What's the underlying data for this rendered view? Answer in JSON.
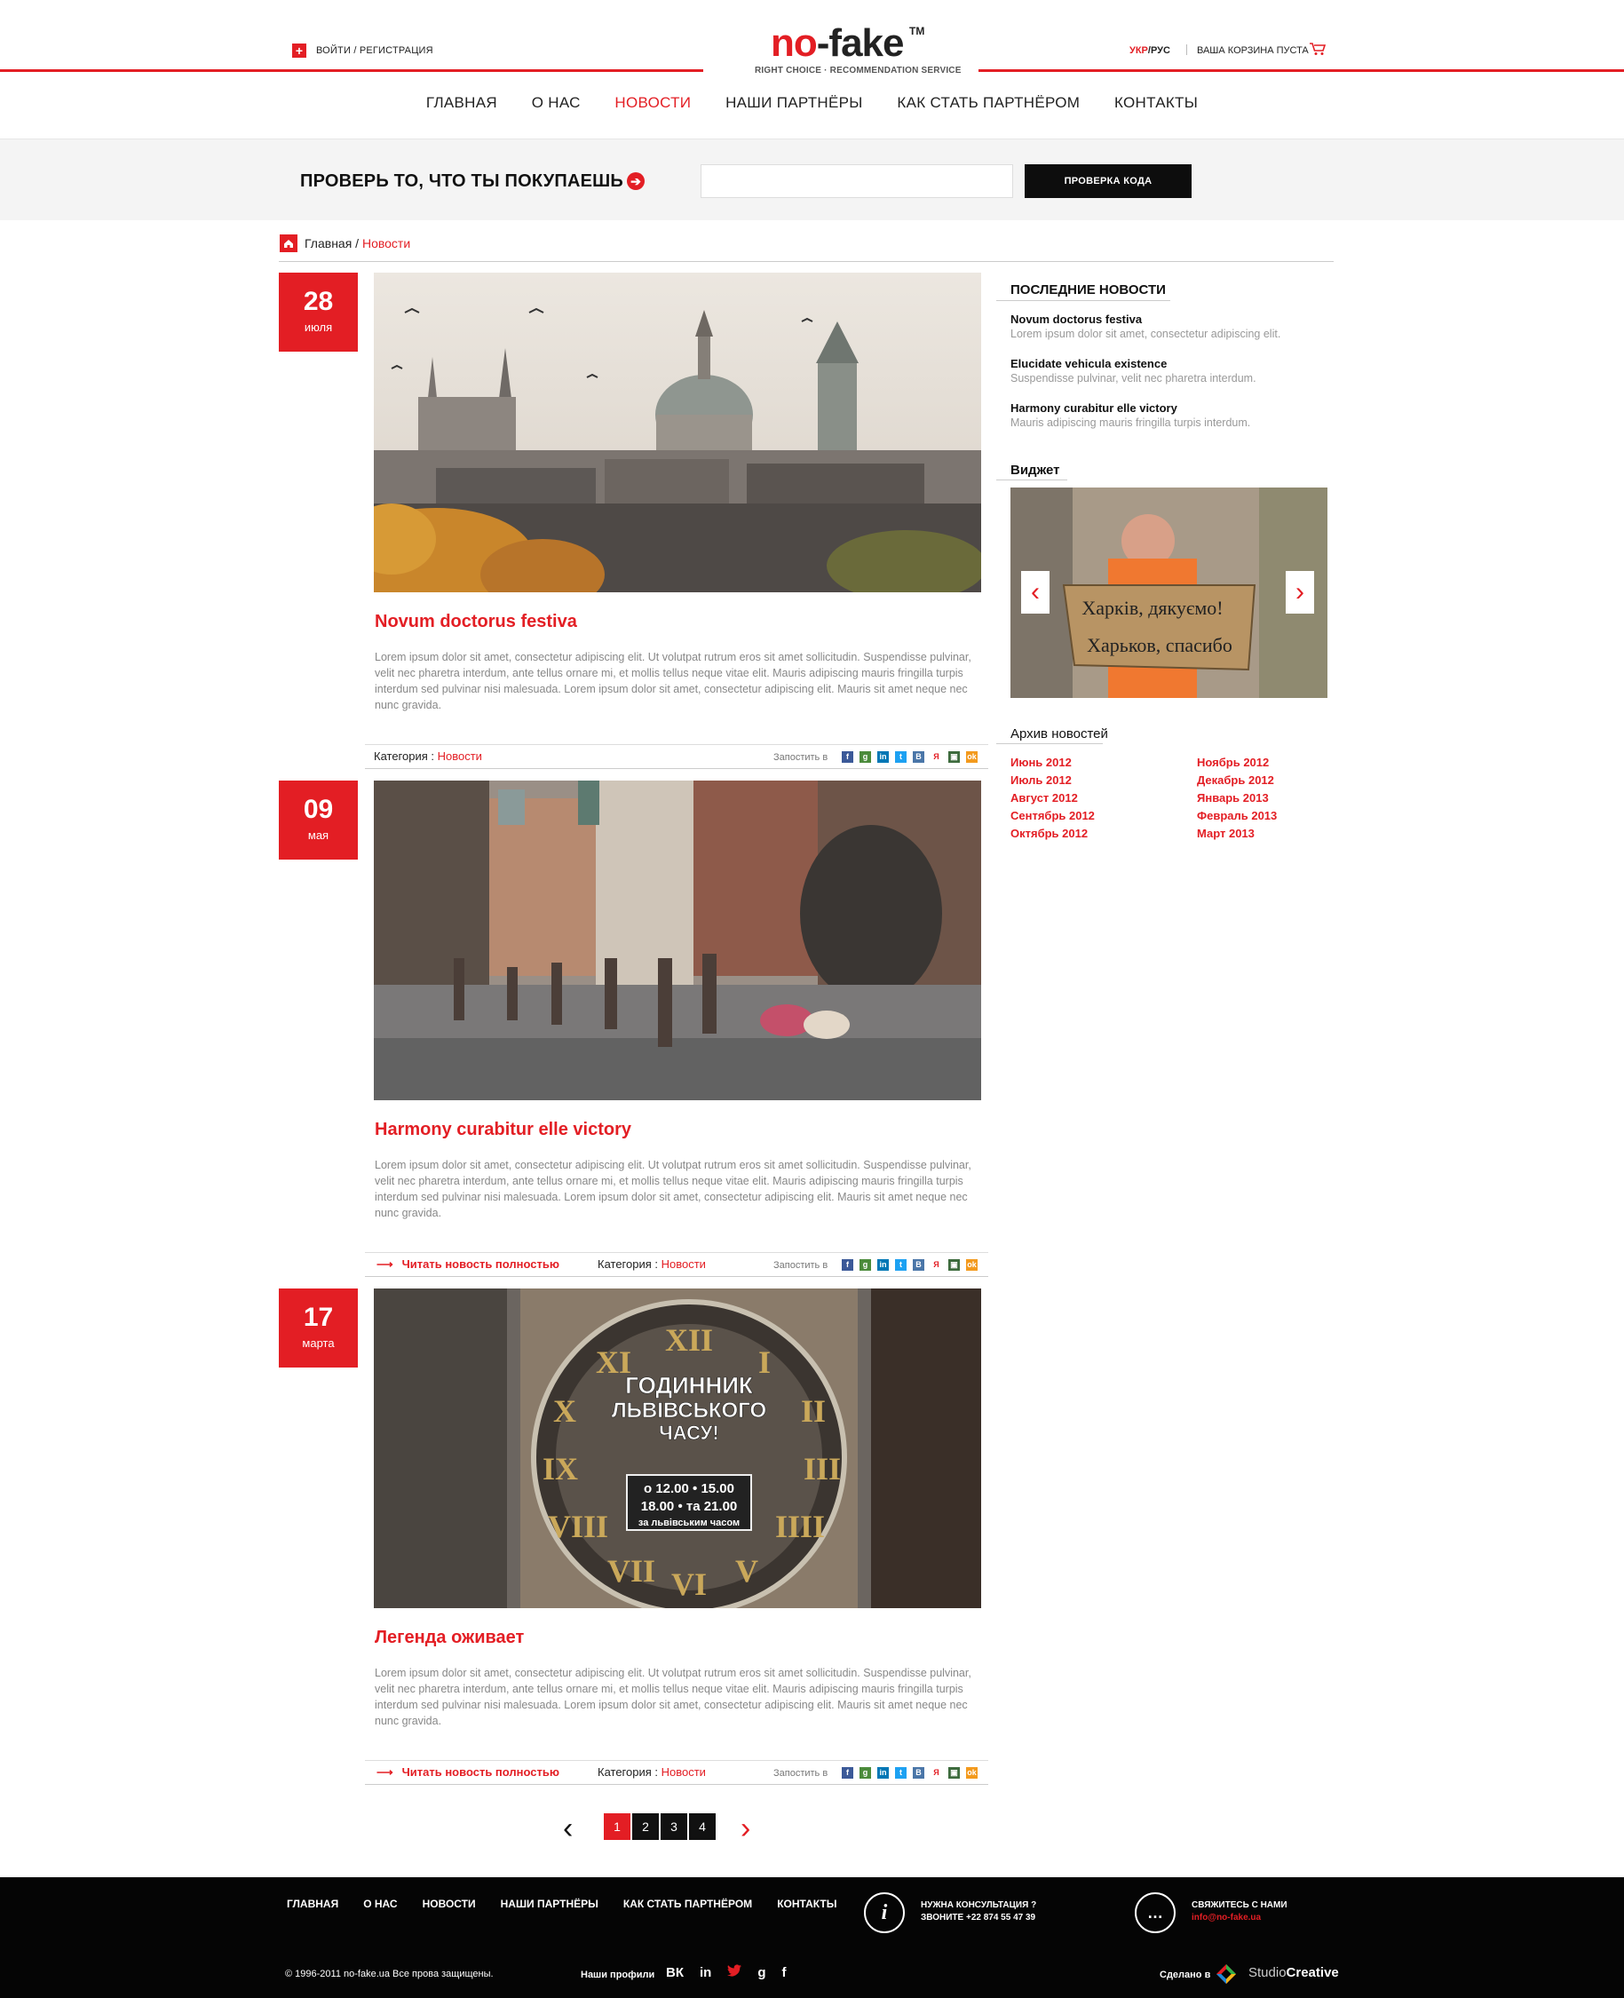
{
  "header": {
    "login_label": "ВОЙТИ / РЕГИСТРАЦИЯ",
    "logo_part1": "no",
    "logo_part2": "-fake",
    "logo_tm": "TM",
    "logo_tagline": "RIGHT CHOICE · RECOMMENDATION SERVICE",
    "lang_ukr": "УКР",
    "lang_sep": "/",
    "lang_rus": "РУС",
    "cart_label": "ВАША КОРЗИНА ПУСТА"
  },
  "nav": {
    "items": [
      "ГЛАВНАЯ",
      "О НАС",
      "НОВОСТИ",
      "НАШИ ПАРТНЁРЫ",
      "КАК СТАТЬ ПАРТНЁРОМ",
      "КОНТАКТЫ"
    ],
    "active": "НОВОСТИ"
  },
  "search": {
    "title": "ПРОВЕРЬ ТО, ЧТО ТЫ ПОКУПАЕШЬ",
    "input_value": "",
    "button_label": "ПРОВЕРКА КОДА"
  },
  "breadcrumb": {
    "home": "Главная",
    "sep": " / ",
    "current": "Новости"
  },
  "posts": [
    {
      "day": "28",
      "month": "июля",
      "title": "Novum doctorus festiva",
      "text": "Lorem ipsum dolor sit amet, consectetur adipiscing elit. Ut volutpat rutrum eros sit amet sollicitudin. Suspendisse pulvinar, velit nec pharetra interdum, ante tellus ornare mi, et mollis tellus neque vitae elit. Mauris adipiscing mauris fringilla turpis interdum sed pulvinar nisi malesuada. Lorem ipsum dolor sit amet, consectetur adipiscing elit. Mauris sit amet neque nec nunc gravida.",
      "read_more": "",
      "category_label": "Категория : ",
      "category": "Новости",
      "share_label": "Запостить в"
    },
    {
      "day": "09",
      "month": "мая",
      "title": "Harmony curabitur elle victory",
      "text": "Lorem ipsum dolor sit amet, consectetur adipiscing elit. Ut volutpat rutrum eros sit amet sollicitudin. Suspendisse pulvinar, velit nec pharetra interdum, ante tellus ornare mi, et mollis tellus neque vitae elit. Mauris adipiscing mauris fringilla turpis interdum sed pulvinar nisi malesuada. Lorem ipsum dolor sit amet, consectetur adipiscing elit. Mauris sit amet neque nec nunc gravida.",
      "read_more": "Читать новость полностью",
      "category_label": "Категория : ",
      "category": "Новости",
      "share_label": "Запостить в"
    },
    {
      "day": "17",
      "month": "марта",
      "title": "Легенда оживает",
      "text": "Lorem ipsum dolor sit amet, consectetur adipiscing elit. Ut volutpat rutrum eros sit amet sollicitudin. Suspendisse pulvinar, velit nec pharetra interdum, ante tellus ornare mi, et mollis tellus neque vitae elit. Mauris adipiscing mauris fringilla turpis interdum sed pulvinar nisi malesuada. Lorem ipsum dolor sit amet, consectetur adipiscing elit. Mauris sit amet neque nec nunc gravida.",
      "read_more": "Читать новость полностью",
      "category_label": "Категория : ",
      "category": "Новости",
      "share_label": "Запостить в"
    }
  ],
  "clock_sign": {
    "line1": "ГОДИННИК",
    "line2": "ЛЬВІВСЬКОГО",
    "line3": "ЧАСУ!",
    "line4": "о 12.00 • 15.00",
    "line5": "18.00 • та 21.00",
    "line6": "за львівським часом"
  },
  "share_icons": [
    "facebook",
    "google",
    "linkedin",
    "twitter",
    "vkontakte",
    "yandex",
    "livejournal",
    "odnoklassniki"
  ],
  "pagination": {
    "pages": [
      "1",
      "2",
      "3",
      "4"
    ],
    "current": "1"
  },
  "sidebar": {
    "latest_title": "ПОСЛЕДНИЕ НОВОСТИ",
    "latest": [
      {
        "title": "Novum doctorus festiva",
        "desc": "Lorem ipsum dolor sit amet, consectetur adipiscing elit."
      },
      {
        "title": "Elucidate vehicula existence",
        "desc": "Suspendisse pulvinar, velit nec pharetra interdum."
      },
      {
        "title": "Harmony curabitur elle victory",
        "desc": "Mauris adipiscing mauris fringilla turpis interdum."
      }
    ],
    "widget_title": "Виджет",
    "widget_sign1": "Харків, дякуємо!",
    "widget_sign2": "Харьков, спасибо",
    "archive_title": "Архив новостей",
    "archive_left": [
      "Июнь 2012",
      "Июль 2012",
      "Август 2012",
      "Сентябрь 2012",
      "Октябрь 2012"
    ],
    "archive_right": [
      "Ноябрь 2012",
      "Декабрь 2012",
      "Январь 2013",
      "Февраль 2013",
      "Март 2013"
    ]
  },
  "footer": {
    "nav": [
      "ГЛАВНАЯ",
      "О НАС",
      "НОВОСТИ",
      "НАШИ ПАРТНЁРЫ",
      "КАК СТАТЬ ПАРТНЁРОМ",
      "КОНТАКТЫ"
    ],
    "consult_line1": "НУЖНА КОНСУЛЬТАЦИЯ ?",
    "consult_line2": "ЗВОНИТЕ +22 874 55 47 39",
    "contact_line1": "СВЯЖИТЕСЬ С НАМИ",
    "contact_email": "info@no-fake.ua",
    "copyright": "© 1996-2011 no-fake.ua Все прова защищены.",
    "profiles_label": "Наши профили",
    "profiles": [
      "ВК",
      "in",
      "twitter",
      "g",
      "f"
    ],
    "made_label": "Сделано в",
    "studio_light": "Studio",
    "studio_bold": "Creative"
  },
  "colors": {
    "accent": "#e31e24",
    "dark": "#0d0d0d",
    "band": "#f4f4f4"
  }
}
